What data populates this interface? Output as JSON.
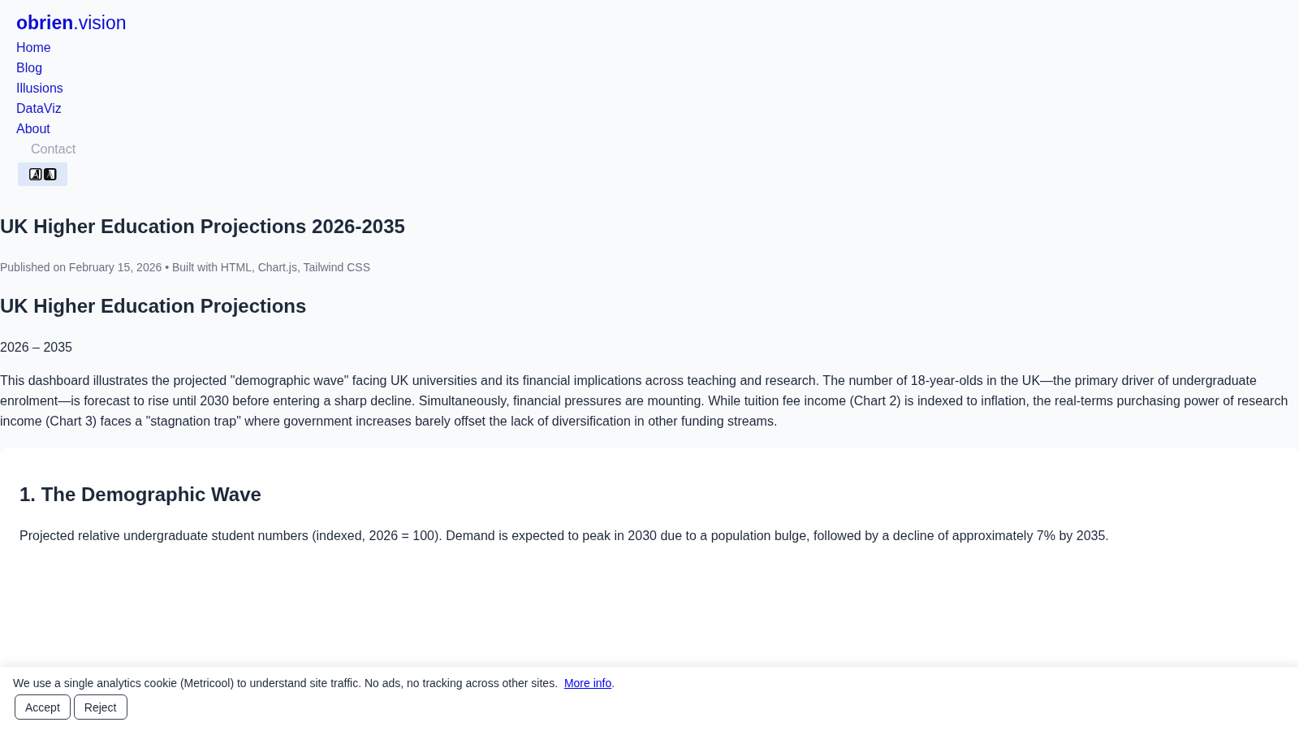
{
  "header": {
    "logo": "**obrien**.vision",
    "nav": [
      {
        "label": "Home",
        "kind": "link"
      },
      {
        "label": "Blog",
        "kind": "link"
      },
      {
        "label": "Illusions",
        "kind": "link"
      },
      {
        "label": "DataViz",
        "kind": "link"
      },
      {
        "label": "About",
        "kind": "link"
      },
      {
        "label": "Contact",
        "kind": "button"
      }
    ]
  },
  "article": {
    "title": "UK Higher Education Projections 2026-2035",
    "meta": "Published on February 15, 2026 • Built with HTML, Chart.js, Tailwind CSS",
    "heading": "UK Higher Education Projections",
    "years": "2026 – 2035",
    "intro": "This dashboard illustrates the projected \"demographic wave\" facing UK universities and its financial implications across teaching and research. The number of 18-year-olds in the UK—the primary driver of undergraduate enrolment—is forecast to rise until 2030 before entering a sharp decline. Simultaneously, financial pressures are mounting. While tuition fee income (Chart 2) is indexed to inflation, the real-terms purchasing power of research income (Chart 3) faces a \"stagnation trap\" where government increases barely offset the lack of diversification in other funding streams."
  },
  "sections": [
    {
      "title": "1. The Demographic Wave",
      "description": "Projected relative undergraduate student numbers (indexed, 2026 = 100). Demand is expected to peak in 2030 due to a population bulge, followed by a decline of approximately 7% by 2035."
    }
  ],
  "cookie_banner": {
    "text": "We use a single analytics cookie (Metricool) to understand site traffic. No ads, no tracking across other sites.",
    "link": "More info",
    "after_link": ".",
    "buttons": [
      "Accept",
      "Reject"
    ]
  }
}
